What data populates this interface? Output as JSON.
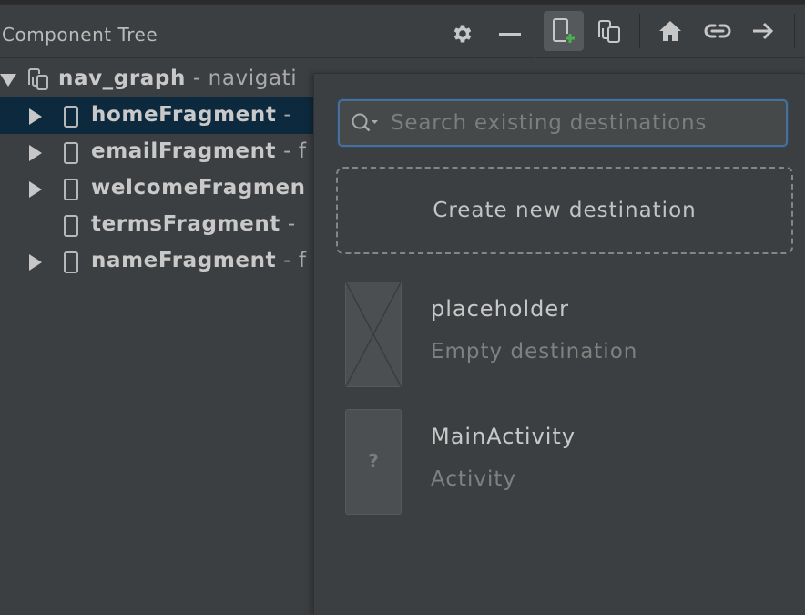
{
  "header": {
    "title": "Component Tree"
  },
  "tree": {
    "items": [
      {
        "name": "nav_graph",
        "suffix": " - navigati",
        "expanded": true,
        "selected": false
      },
      {
        "name": "homeFragment",
        "suffix": " -",
        "expanded": false,
        "selected": true
      },
      {
        "name": "emailFragment",
        "suffix": " - f",
        "expanded": false,
        "selected": false
      },
      {
        "name": "welcomeFragmen",
        "suffix": "",
        "expanded": false,
        "selected": false
      },
      {
        "name": "termsFragment",
        "suffix": " -",
        "expanded": null,
        "selected": false
      },
      {
        "name": "nameFragment",
        "suffix": " - f",
        "expanded": false,
        "selected": false
      }
    ]
  },
  "toolbar": {
    "icons": [
      "new-destination-icon",
      "nested-graph-icon",
      "home-icon",
      "link-icon",
      "arrow-right-icon"
    ],
    "active": "new-destination-icon"
  },
  "popup": {
    "search_placeholder": "Search existing destinations",
    "create_label": "Create new destination",
    "destinations": [
      {
        "name": "placeholder",
        "type": "Empty destination",
        "thumb": "placeholder"
      },
      {
        "name": "MainActivity",
        "type": "Activity",
        "thumb_text": "?"
      }
    ]
  },
  "colors": {
    "background": "#3c3f41",
    "selection": "#0d293e",
    "search_focus": "#4d6e95",
    "add_green": "#4caf50"
  }
}
